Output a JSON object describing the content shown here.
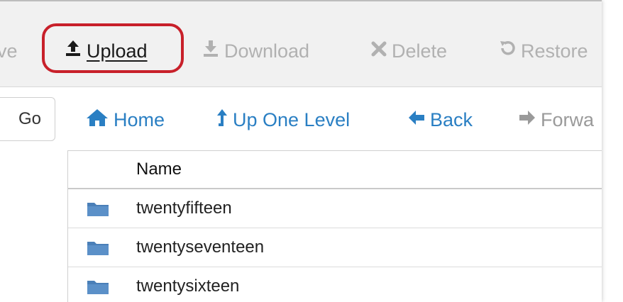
{
  "toolbar": {
    "items": [
      {
        "label": "ve",
        "icon": "save-icon"
      },
      {
        "label": "Upload",
        "icon": "upload-icon"
      },
      {
        "label": "Download",
        "icon": "download-icon"
      },
      {
        "label": "Delete",
        "icon": "close-icon"
      },
      {
        "label": "Restore",
        "icon": "undo-icon"
      }
    ]
  },
  "nav": {
    "go_label": "Go",
    "items": [
      {
        "label": "Home",
        "icon": "home-icon"
      },
      {
        "label": "Up One Level",
        "icon": "arrow-up-icon"
      },
      {
        "label": "Back",
        "icon": "arrow-left-icon"
      },
      {
        "label": "Forwa",
        "icon": "arrow-right-icon"
      }
    ]
  },
  "table": {
    "columns": [
      "Name"
    ],
    "rows": [
      {
        "name": "twentyfifteen",
        "icon": "folder-icon"
      },
      {
        "name": "twentyseventeen",
        "icon": "folder-icon"
      },
      {
        "name": "twentysixteen",
        "icon": "folder-icon"
      }
    ]
  },
  "colors": {
    "highlight": "#c8202a",
    "link": "#2a7fc3",
    "disabled": "#b1b1b1",
    "folder": "#4a7fb8"
  }
}
